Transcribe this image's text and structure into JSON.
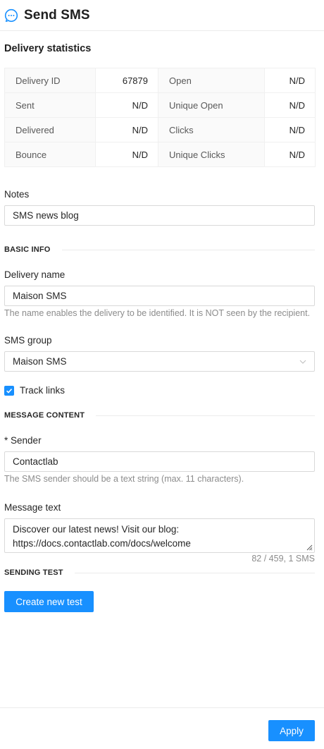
{
  "header": {
    "title": "Send SMS",
    "icon": "chat-bubble-icon"
  },
  "stats": {
    "heading": "Delivery statistics",
    "rows": [
      {
        "l1": "Delivery ID",
        "v1": "67879",
        "l2": "Open",
        "v2": "N/D"
      },
      {
        "l1": "Sent",
        "v1": "N/D",
        "l2": "Unique Open",
        "v2": "N/D"
      },
      {
        "l1": "Delivered",
        "v1": "N/D",
        "l2": "Clicks",
        "v2": "N/D"
      },
      {
        "l1": "Bounce",
        "v1": "N/D",
        "l2": "Unique Clicks",
        "v2": "N/D"
      }
    ]
  },
  "notes": {
    "label": "Notes",
    "value": "SMS news blog"
  },
  "basic_info": {
    "heading": "BASIC INFO",
    "delivery_name": {
      "label": "Delivery name",
      "value": "Maison SMS",
      "help": "The name enables the delivery to be identified. It is NOT seen by the recipient."
    },
    "sms_group": {
      "label": "SMS group",
      "selected": "Maison SMS"
    },
    "track_links": {
      "label": "Track links",
      "checked": true
    }
  },
  "message_content": {
    "heading": "MESSAGE CONTENT",
    "sender": {
      "required_mark": "*",
      "label": "Sender",
      "value": "Contactlab",
      "help": "The SMS sender should be a text string (max. 11 characters)."
    },
    "message_text": {
      "label": "Message text",
      "value": "Discover our latest news! Visit our blog: https://docs.contactlab.com/docs/welcome",
      "counter": "82 / 459, 1 SMS"
    }
  },
  "sending_test": {
    "heading": "SENDING TEST",
    "button_label": "Create new test"
  },
  "footer": {
    "apply_label": "Apply"
  },
  "colors": {
    "primary": "#1890ff",
    "border": "#d9d9d9",
    "help_text": "#8c8c8c"
  }
}
